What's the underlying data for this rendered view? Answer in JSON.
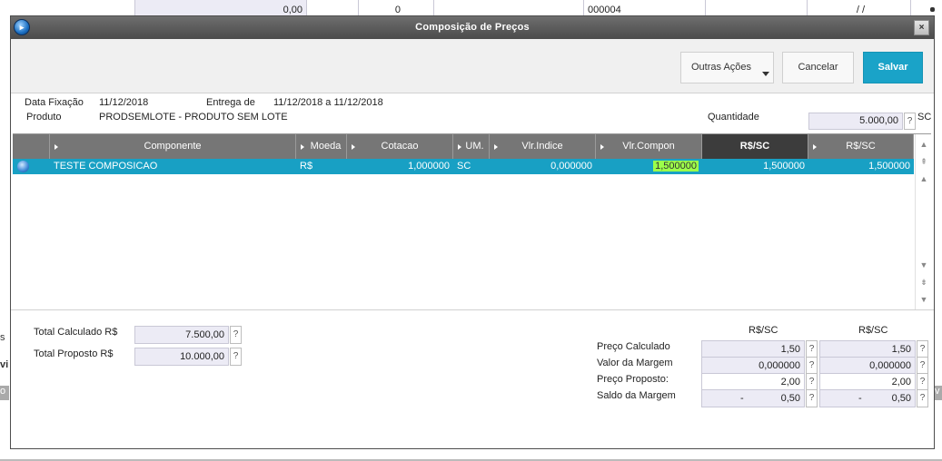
{
  "background": {
    "field1_value": "0,00",
    "field2_value": "0",
    "field3_value": "000004",
    "field4_value": "/ /",
    "left_marks": [
      "s",
      "vi",
      "o"
    ],
    "right_marks": [
      "v"
    ]
  },
  "dialog": {
    "title": "Composição de Preços",
    "close_label": "×"
  },
  "toolbar": {
    "outras_acoes": "Outras Ações",
    "cancelar": "Cancelar",
    "salvar": "Salvar"
  },
  "header": {
    "data_fixacao_label": "Data Fixação",
    "data_fixacao_value": "11/12/2018",
    "entrega_label": "Entrega de",
    "entrega_value": "11/12/2018 a 11/12/2018",
    "produto_label": "Produto",
    "produto_value": "PRODSEMLOTE - PRODUTO SEM LOTE",
    "quantidade_label": "Quantidade",
    "quantidade_value": "5.000,00",
    "quantidade_unit": "SC",
    "help": "?"
  },
  "grid": {
    "columns": [
      "Componente",
      "Moeda",
      "Cotacao",
      "UM.",
      "Vlr.Indice",
      "Vlr.Compon",
      "R$/SC",
      "R$/SC"
    ],
    "rows": [
      {
        "componente": "TESTE COMPOSICAO",
        "moeda": "R$",
        "cotacao": "1,000000",
        "um": "SC",
        "vlr_indice": "0,000000",
        "vlr_compon": "1,500000",
        "rs_sc_1": "1,500000",
        "rs_sc_2": "1,500000"
      }
    ]
  },
  "totals": {
    "total_calculado_label": "Total Calculado R$",
    "total_calculado_value": "7.500,00",
    "total_proposto_label": "Total Proposto R$",
    "total_proposto_value": "10.000,00",
    "col_header_1": "R$/SC",
    "col_header_2": "R$/SC",
    "preco_calculado_label": "Preço Calculado",
    "preco_calculado_1": "1,50",
    "preco_calculado_2": "1,50",
    "valor_margem_label": "Valor da Margem",
    "valor_margem_1": "0,000000",
    "valor_margem_2": "0,000000",
    "preco_proposto_label": "Preço Proposto:",
    "preco_proposto_1": "2,00",
    "preco_proposto_2": "2,00",
    "saldo_margem_label": "Saldo da Margem",
    "saldo_margem_sign": "-",
    "saldo_margem_1": "0,50",
    "saldo_margem_2": "0,50",
    "help": "?"
  },
  "colors": {
    "accent": "#1aa3c8",
    "grid_header": "#767676",
    "highlight": "#9cff4a"
  }
}
